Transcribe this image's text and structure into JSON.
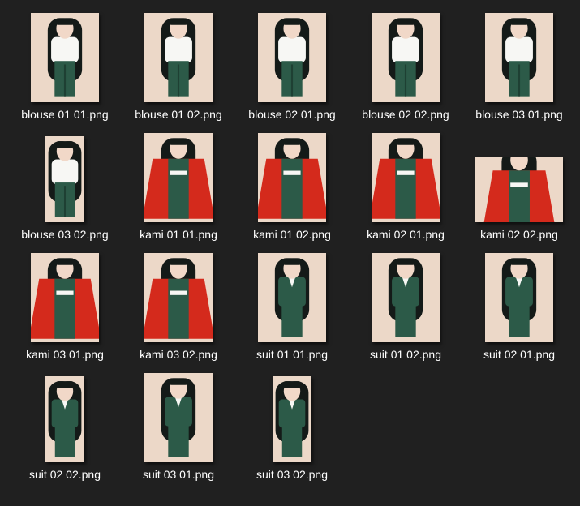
{
  "files": [
    {
      "name": "blouse 01 01.png",
      "outfit": "blouse",
      "aspect": "tall"
    },
    {
      "name": "blouse 01 02.png",
      "outfit": "blouse",
      "aspect": "tall"
    },
    {
      "name": "blouse 02 01.png",
      "outfit": "blouse",
      "aspect": "tall"
    },
    {
      "name": "blouse 02 02.png",
      "outfit": "blouse",
      "aspect": "tall"
    },
    {
      "name": "blouse 03 01.png",
      "outfit": "blouse",
      "aspect": "tall"
    },
    {
      "name": "blouse 03 02.png",
      "outfit": "blouse",
      "aspect": "narrow"
    },
    {
      "name": "kami 01 01.png",
      "outfit": "kami",
      "aspect": "tall"
    },
    {
      "name": "kami 01 02.png",
      "outfit": "kami",
      "aspect": "tall"
    },
    {
      "name": "kami 02 01.png",
      "outfit": "kami",
      "aspect": "tall"
    },
    {
      "name": "kami 02 02.png",
      "outfit": "kami",
      "aspect": "wide"
    },
    {
      "name": "kami 03 01.png",
      "outfit": "kami",
      "aspect": "tall"
    },
    {
      "name": "kami 03 02.png",
      "outfit": "kami",
      "aspect": "tall"
    },
    {
      "name": "suit 01 01.png",
      "outfit": "suit",
      "aspect": "tall"
    },
    {
      "name": "suit 01 02.png",
      "outfit": "suit",
      "aspect": "tall"
    },
    {
      "name": "suit 02 01.png",
      "outfit": "suit",
      "aspect": "tall"
    },
    {
      "name": "suit 02 02.png",
      "outfit": "suit",
      "aspect": "narrow"
    },
    {
      "name": "suit 03 01.png",
      "outfit": "suit",
      "aspect": "tall"
    },
    {
      "name": "suit 03 02.png",
      "outfit": "suit",
      "aspect": "narrow"
    }
  ],
  "colors": {
    "background": "#202020",
    "thumb_bg": "#ecd8c8",
    "hair": "#141a18",
    "skin": "#f1d8c8",
    "green": "#2c5a48",
    "red": "#d42a1c",
    "white": "#f7f7f4",
    "label": "#ffffff"
  }
}
